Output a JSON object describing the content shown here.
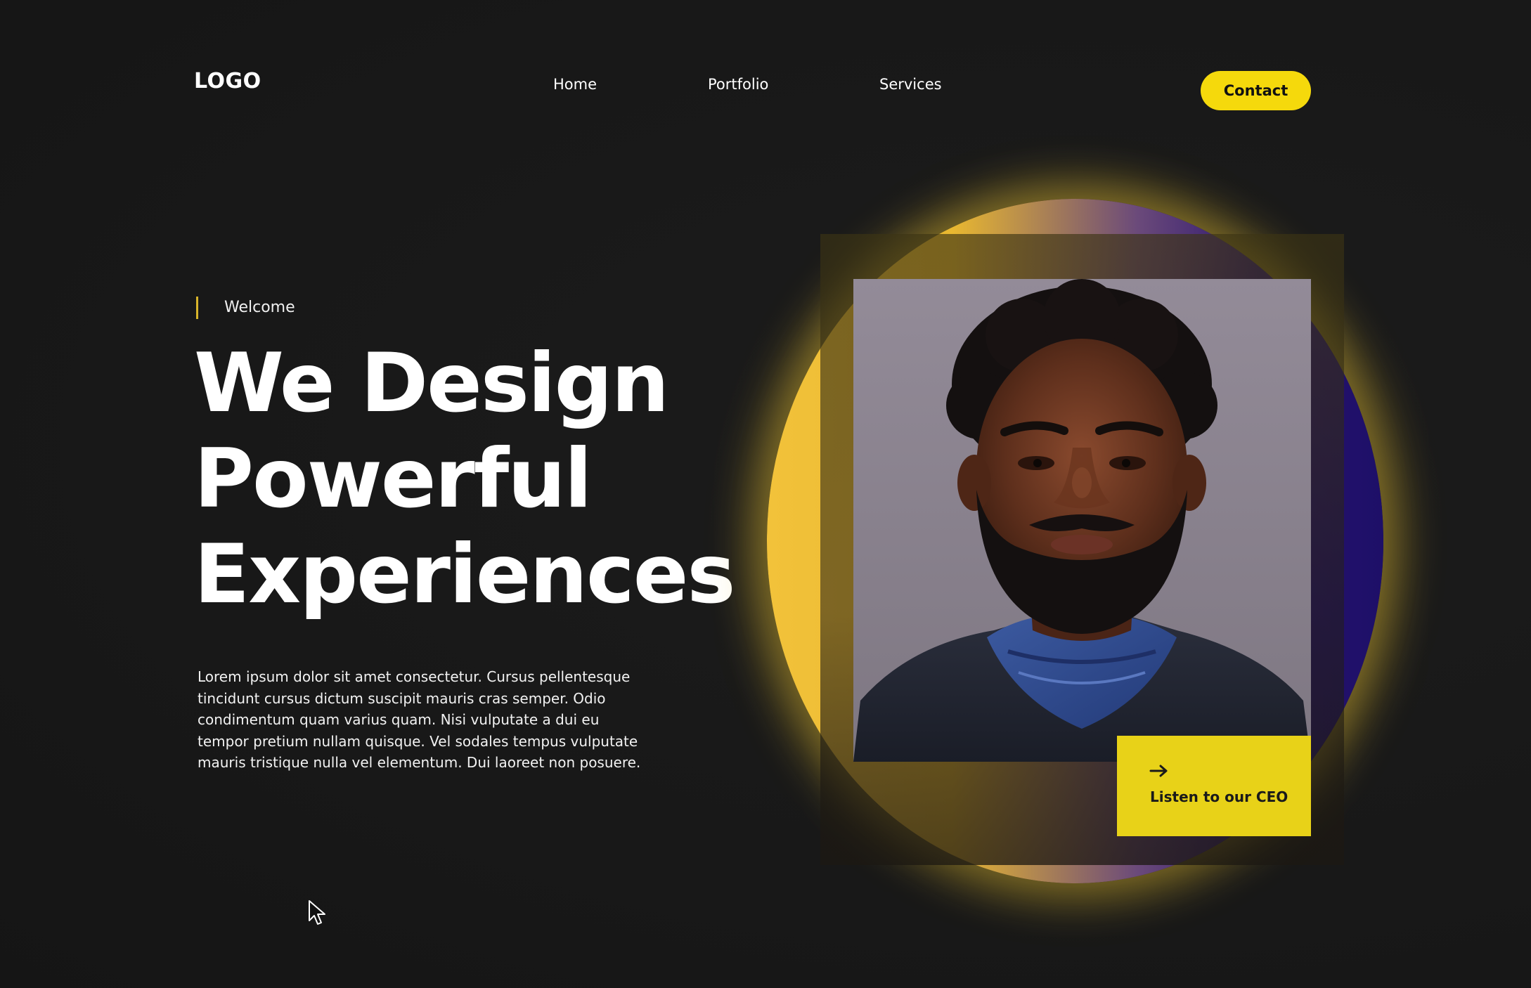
{
  "nav": {
    "logo": "LOGO",
    "links": [
      "Home",
      "Portfolio",
      "Services"
    ],
    "contact": "Contact"
  },
  "hero": {
    "eyebrow": "Welcome",
    "headline": [
      "We Design",
      "Powerful",
      "Experiences"
    ],
    "body": "Lorem ipsum dolor sit amet consectetur. Cursus pellentesque tincidunt cursus dictum suscipit mauris cras semper. Odio condimentum quam varius quam. Nisi vulputate a dui eu tempor pretium nullam quisque. Vel sodales tempus vulputate mauris tristique nulla vel elementum. Dui laoreet non posuere.",
    "cta": "Listen to our CEO",
    "cta_icon": "arrow-right-icon"
  },
  "colors": {
    "background": "#191919",
    "accent_yellow": "#f5d90c",
    "orb_yellow": "#f2c23a",
    "orb_purple": "#1d0f68",
    "text": "#ffffff"
  }
}
